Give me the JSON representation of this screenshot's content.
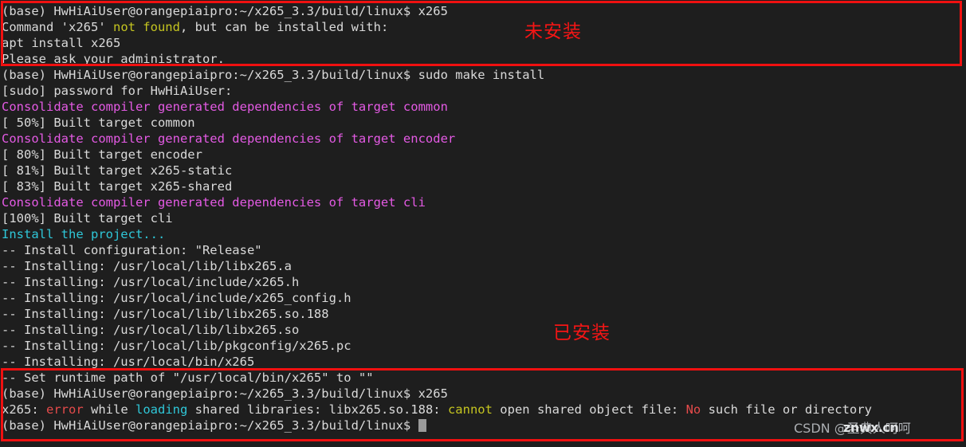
{
  "terminal": {
    "background_color": "#1e1e1e",
    "foreground_color": "#dadada",
    "cursor_color": "#9a9a9a",
    "prompt": "(base) HwHiAiUser@orangepiaipro:~/x265_3.3/build/linux$ ",
    "lines": [
      {
        "id": "line-01",
        "segments": [
          {
            "t": "(base) HwHiAiUser@orangepiaipro:~/x265_3.3/build/linux$ x265",
            "c": "c-white"
          }
        ]
      },
      {
        "id": "line-02",
        "segments": [
          {
            "t": "Command 'x265' ",
            "c": "c-white"
          },
          {
            "t": "not found",
            "c": "c-yellow"
          },
          {
            "t": ", but can be installed with:",
            "c": "c-white"
          }
        ]
      },
      {
        "id": "line-03",
        "segments": [
          {
            "t": "apt install x265",
            "c": "c-white"
          }
        ]
      },
      {
        "id": "line-04",
        "segments": [
          {
            "t": "Please ask your administrator.",
            "c": "c-white"
          }
        ]
      },
      {
        "id": "line-05",
        "segments": [
          {
            "t": "(base) HwHiAiUser@orangepiaipro:~/x265_3.3/build/linux$ sudo make install",
            "c": "c-white"
          }
        ]
      },
      {
        "id": "line-06",
        "segments": [
          {
            "t": "[sudo] password for HwHiAiUser:",
            "c": "c-white"
          }
        ]
      },
      {
        "id": "line-07",
        "segments": [
          {
            "t": "Consolidate compiler generated dependencies of target common",
            "c": "c-magenta"
          }
        ]
      },
      {
        "id": "line-08",
        "segments": [
          {
            "t": "[ 50%] Built target common",
            "c": "c-white"
          }
        ]
      },
      {
        "id": "line-09",
        "segments": [
          {
            "t": "Consolidate compiler generated dependencies of target encoder",
            "c": "c-magenta"
          }
        ]
      },
      {
        "id": "line-10",
        "segments": [
          {
            "t": "[ 80%] Built target encoder",
            "c": "c-white"
          }
        ]
      },
      {
        "id": "line-11",
        "segments": [
          {
            "t": "[ 81%] Built target x265-static",
            "c": "c-white"
          }
        ]
      },
      {
        "id": "line-12",
        "segments": [
          {
            "t": "[ 83%] Built target x265-shared",
            "c": "c-white"
          }
        ]
      },
      {
        "id": "line-13",
        "segments": [
          {
            "t": "Consolidate compiler generated dependencies of target cli",
            "c": "c-magenta"
          }
        ]
      },
      {
        "id": "line-14",
        "segments": [
          {
            "t": "[100%] Built target cli",
            "c": "c-white"
          }
        ]
      },
      {
        "id": "line-15",
        "segments": [
          {
            "t": "Install the project...",
            "c": "c-cyan"
          }
        ]
      },
      {
        "id": "line-16",
        "segments": [
          {
            "t": "-- Install configuration: \"Release\"",
            "c": "c-white"
          }
        ]
      },
      {
        "id": "line-17",
        "segments": [
          {
            "t": "-- Installing: /usr/local/lib/libx265.a",
            "c": "c-white"
          }
        ]
      },
      {
        "id": "line-18",
        "segments": [
          {
            "t": "-- Installing: /usr/local/include/x265.h",
            "c": "c-white"
          }
        ]
      },
      {
        "id": "line-19",
        "segments": [
          {
            "t": "-- Installing: /usr/local/include/x265_config.h",
            "c": "c-white"
          }
        ]
      },
      {
        "id": "line-20",
        "segments": [
          {
            "t": "-- Installing: /usr/local/lib/libx265.so.188",
            "c": "c-white"
          }
        ]
      },
      {
        "id": "line-21",
        "segments": [
          {
            "t": "-- Installing: /usr/local/lib/libx265.so",
            "c": "c-white"
          }
        ]
      },
      {
        "id": "line-22",
        "segments": [
          {
            "t": "-- Installing: /usr/local/lib/pkgconfig/x265.pc",
            "c": "c-white"
          }
        ]
      },
      {
        "id": "line-23",
        "segments": [
          {
            "t": "-- Installing: /usr/local/bin/x265",
            "c": "c-white"
          }
        ]
      },
      {
        "id": "line-24",
        "segments": [
          {
            "t": "-- Set runtime path of \"/usr/local/bin/x265\" to \"\"",
            "c": "c-white"
          }
        ]
      },
      {
        "id": "line-25",
        "segments": [
          {
            "t": "(base) HwHiAiUser@orangepiaipro:~/x265_3.3/build/linux$ x265",
            "c": "c-white"
          }
        ]
      },
      {
        "id": "line-26",
        "segments": [
          {
            "t": "x265: ",
            "c": "c-white"
          },
          {
            "t": "error",
            "c": "c-red"
          },
          {
            "t": " while ",
            "c": "c-white"
          },
          {
            "t": "loading",
            "c": "c-cyan"
          },
          {
            "t": " shared libraries: libx265.so.188: ",
            "c": "c-white"
          },
          {
            "t": "cannot",
            "c": "c-yellow"
          },
          {
            "t": " open shared object file: ",
            "c": "c-white"
          },
          {
            "t": "No",
            "c": "c-red"
          },
          {
            "t": " such file or directory",
            "c": "c-white"
          }
        ]
      },
      {
        "id": "line-27",
        "segments": [
          {
            "t": "(base) HwHiAiUser@orangepiaipro:~/x265_3.3/build/linux$ ",
            "c": "c-white"
          },
          {
            "cursor": true
          }
        ]
      }
    ]
  },
  "annotations": {
    "color": "#f51515",
    "not_installed": "未安装",
    "installed": "已安装"
  },
  "highlight_boxes": {
    "color": "#f01010",
    "top_label": "not-installed-region",
    "bottom_label": "installed-error-region"
  },
  "watermark": {
    "text": "CSDN @圣典人呵呵",
    "overlay": "znwx.cn"
  }
}
